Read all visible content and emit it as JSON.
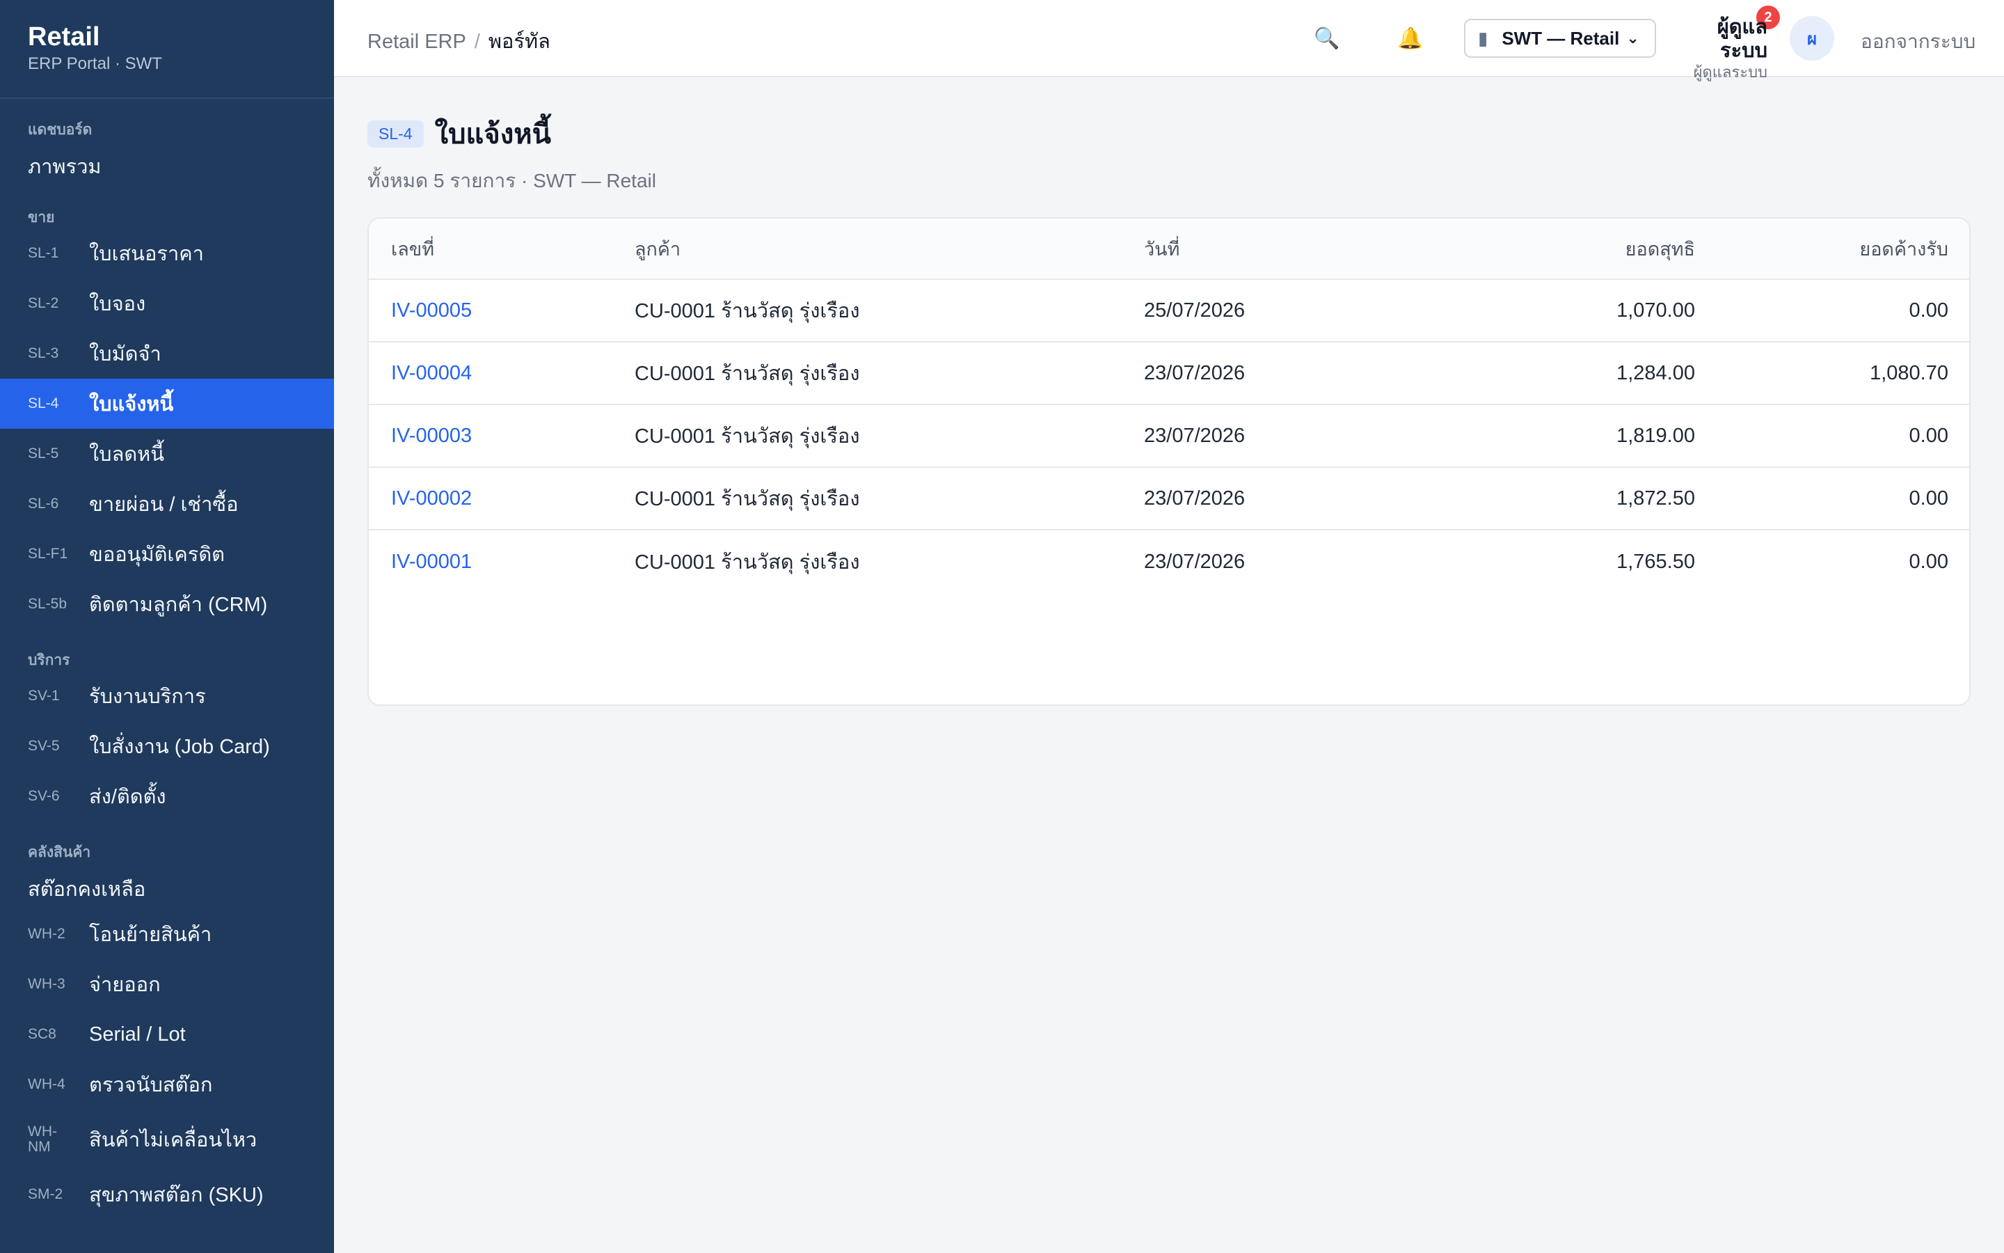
{
  "brand": {
    "title": "Retail",
    "subtitle": "ERP Portal · SWT"
  },
  "sidebar": {
    "sections": [
      {
        "title": "แดชบอร์ด",
        "items": [
          {
            "code": "",
            "label": "ภาพรวม"
          }
        ]
      },
      {
        "title": "ขาย",
        "items": [
          {
            "code": "SL-1",
            "label": "ใบเสนอราคา"
          },
          {
            "code": "SL-2",
            "label": "ใบจอง"
          },
          {
            "code": "SL-3",
            "label": "ใบมัดจำ"
          },
          {
            "code": "SL-4",
            "label": "ใบแจ้งหนี้"
          },
          {
            "code": "SL-5",
            "label": "ใบลดหนี้"
          },
          {
            "code": "SL-6",
            "label": "ขายผ่อน / เช่าซื้อ"
          },
          {
            "code": "SL-F1",
            "label": "ขออนุมัติเครดิต"
          },
          {
            "code": "SL-5b",
            "label": "ติดตามลูกค้า (CRM)"
          }
        ]
      },
      {
        "title": "บริการ",
        "items": [
          {
            "code": "SV-1",
            "label": "รับงานบริการ"
          },
          {
            "code": "SV-5",
            "label": "ใบสั่งงาน (Job Card)"
          },
          {
            "code": "SV-6",
            "label": "ส่ง/ติดตั้ง"
          }
        ]
      },
      {
        "title": "คลังสินค้า",
        "items": [
          {
            "code": "",
            "label": "สต๊อกคงเหลือ"
          },
          {
            "code": "WH-2",
            "label": "โอนย้ายสินค้า"
          },
          {
            "code": "WH-3",
            "label": "จ่ายออก"
          },
          {
            "code": "SC8",
            "label": "Serial / Lot"
          },
          {
            "code": "WH-4",
            "label": "ตรวจนับสต๊อก"
          },
          {
            "code": "WH-NM",
            "label": "สินค้าไม่เคลื่อนไหว"
          },
          {
            "code": "SM-2",
            "label": "สุขภาพสต๊อก (SKU)"
          }
        ]
      }
    ],
    "active_code": "SL-4"
  },
  "topbar": {
    "breadcrumb_root": "Retail ERP",
    "breadcrumb_sep": "/",
    "breadcrumb_current": "พอร์ทัล",
    "search_icon": "🔍",
    "bell_icon": "🔔",
    "notification_count": "2",
    "org_icon": "▮",
    "org_value": "SWT — Retail",
    "org_chevron": "⌄",
    "user_name": "ผู้ดูแลระบบ",
    "user_role": "ผู้ดูแลระบบ",
    "avatar_initial": "ผ",
    "logout_label": "ออกจากระบบ"
  },
  "page": {
    "code": "SL-4",
    "title": "ใบแจ้งหนี้",
    "subtitle": "ทั้งหมด 5 รายการ · SWT — Retail"
  },
  "table": {
    "columns": [
      "เลขที่",
      "ลูกค้า",
      "วันที่",
      "ยอดสุทธิ",
      "ยอดค้างรับ"
    ],
    "rows": [
      [
        "IV-00005",
        "CU-0001 ร้านวัสดุ รุ่งเรือง",
        "25/07/2026",
        "1,070.00",
        "0.00"
      ],
      [
        "IV-00004",
        "CU-0001 ร้านวัสดุ รุ่งเรือง",
        "23/07/2026",
        "1,284.00",
        "1,080.70"
      ],
      [
        "IV-00003",
        "CU-0001 ร้านวัสดุ รุ่งเรือง",
        "23/07/2026",
        "1,819.00",
        "0.00"
      ],
      [
        "IV-00002",
        "CU-0001 ร้านวัสดุ รุ่งเรือง",
        "23/07/2026",
        "1,872.50",
        "0.00"
      ],
      [
        "IV-00001",
        "CU-0001 ร้านวัสดุ รุ่งเรือง",
        "23/07/2026",
        "1,765.50",
        "0.00"
      ]
    ]
  },
  "colors": {
    "sidebar": "#1f3a5c",
    "accent": "#2563eb",
    "badge": "#ef4444"
  }
}
